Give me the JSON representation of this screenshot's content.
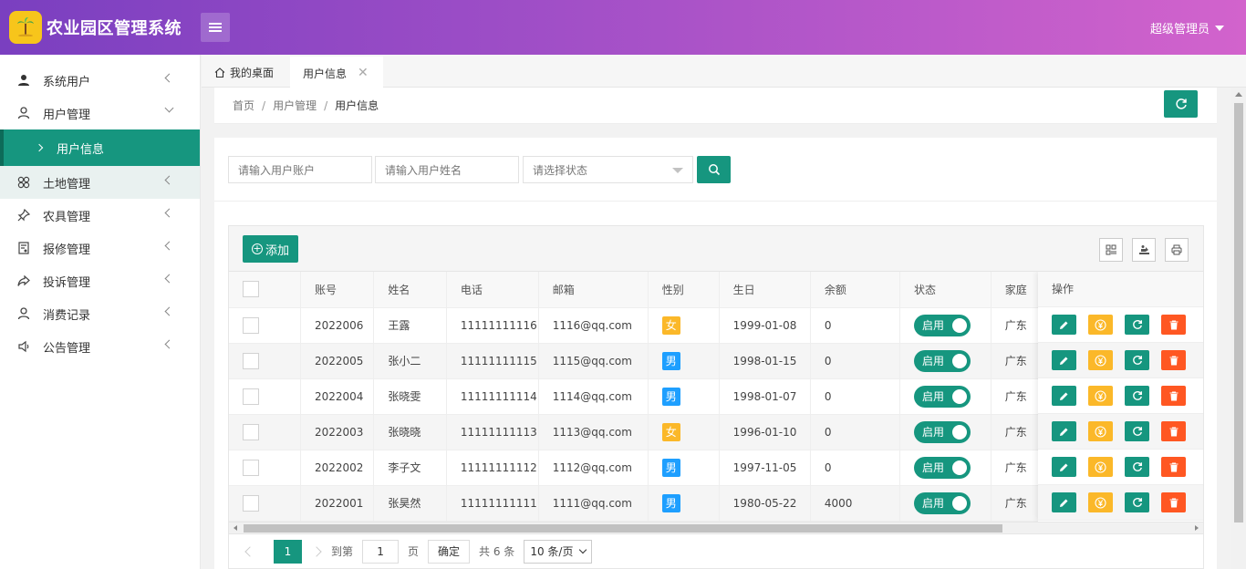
{
  "app": {
    "title": "农业园区管理系统",
    "user": "超级管理员"
  },
  "sidebar": {
    "items": [
      {
        "label": "系统用户",
        "icon": "user-solid-icon",
        "state": "collapsed"
      },
      {
        "label": "用户管理",
        "icon": "user-outline-icon",
        "state": "expanded"
      },
      {
        "label": "用户信息",
        "icon": "chevron-right-icon",
        "state": "active-sub"
      },
      {
        "label": "土地管理",
        "icon": "flower-icon",
        "state": "collapsed-hover"
      },
      {
        "label": "农具管理",
        "icon": "pin-icon",
        "state": "collapsed"
      },
      {
        "label": "报修管理",
        "icon": "form-icon",
        "state": "collapsed"
      },
      {
        "label": "投诉管理",
        "icon": "share-icon",
        "state": "collapsed"
      },
      {
        "label": "消费记录",
        "icon": "user-outline-icon",
        "state": "collapsed"
      },
      {
        "label": "公告管理",
        "icon": "speaker-icon",
        "state": "collapsed"
      }
    ]
  },
  "tabs": {
    "home": "我的桌面",
    "active": "用户信息"
  },
  "breadcrumb": {
    "home": "首页",
    "sep": "/",
    "parent": "用户管理",
    "current": "用户信息"
  },
  "search": {
    "account_placeholder": "请输入用户账户",
    "name_placeholder": "请输入用户姓名",
    "status_placeholder": "请选择状态"
  },
  "toolbar": {
    "add_label": "添加"
  },
  "table": {
    "headers": [
      "账号",
      "姓名",
      "电话",
      "邮箱",
      "性别",
      "生日",
      "余额",
      "状态",
      "家庭",
      "操作"
    ],
    "rows": [
      {
        "account": "2022006",
        "name": "王露",
        "phone": "11111111116",
        "email": "1116@qq.com",
        "gender": "女",
        "birthday": "1999-01-08",
        "balance": "0",
        "status": "启用",
        "home": "广东"
      },
      {
        "account": "2022005",
        "name": "张小二",
        "phone": "11111111115",
        "email": "1115@qq.com",
        "gender": "男",
        "birthday": "1998-01-15",
        "balance": "0",
        "status": "启用",
        "home": "广东"
      },
      {
        "account": "2022004",
        "name": "张晓雯",
        "phone": "11111111114",
        "email": "1114@qq.com",
        "gender": "男",
        "birthday": "1998-01-07",
        "balance": "0",
        "status": "启用",
        "home": "广东"
      },
      {
        "account": "2022003",
        "name": "张晓晓",
        "phone": "11111111113",
        "email": "1113@qq.com",
        "gender": "女",
        "birthday": "1996-01-10",
        "balance": "0",
        "status": "启用",
        "home": "广东"
      },
      {
        "account": "2022002",
        "name": "李子文",
        "phone": "11111111112",
        "email": "1112@qq.com",
        "gender": "男",
        "birthday": "1997-11-05",
        "balance": "0",
        "status": "启用",
        "home": "广东"
      },
      {
        "account": "2022001",
        "name": "张昊然",
        "phone": "11111111111",
        "email": "1111@qq.com",
        "gender": "男",
        "birthday": "1980-05-22",
        "balance": "4000",
        "status": "启用",
        "home": "广东"
      }
    ]
  },
  "pager": {
    "current": "1",
    "goto_label": "到第",
    "goto_value": "1",
    "page_label": "页",
    "confirm_label": "确定",
    "total_label": "共 6 条",
    "size_label": "10 条/页"
  },
  "colors": {
    "primary": "#16967f",
    "warm": "#fbb829",
    "danger": "#ff5722",
    "male": "#1e9fff"
  }
}
